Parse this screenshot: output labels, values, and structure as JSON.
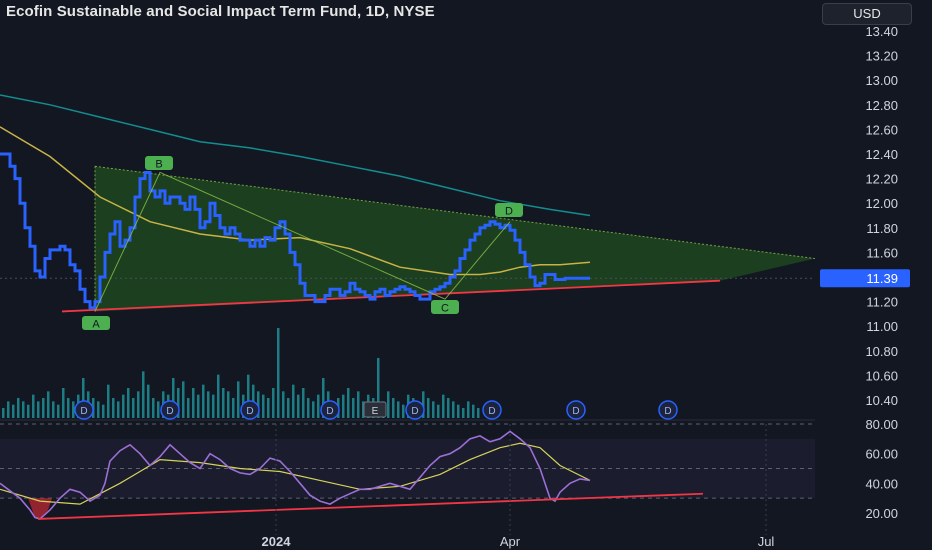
{
  "header": {
    "title": "Ecofin Sustainable and Social Impact Term Fund, 1D, NYSE",
    "currency": "USD"
  },
  "colors": {
    "background": "#131722",
    "price_line": "#2962ff",
    "triangle_fill": "#1f4d1f",
    "triangle_edge": "#8bc34a",
    "support_line": "#f23645",
    "ma_long": "#138d90",
    "ma_mid": "#c9b347",
    "rsi": "#9c6fd6",
    "rsi_ma": "#d6d35a",
    "volume": "#1f8f96",
    "label_green": "#4caf50",
    "price_badge": "#2962ff",
    "dividend_badge": "#2962ff"
  },
  "chart_data": [
    {
      "type": "line",
      "name": "price",
      "y_ticks": [
        "13.40",
        "13.20",
        "13.00",
        "12.80",
        "12.60",
        "12.40",
        "12.20",
        "12.00",
        "11.80",
        "11.60",
        "11.40",
        "11.20",
        "11.00",
        "10.80",
        "10.60",
        "10.40"
      ],
      "ylim": [
        10.35,
        13.45
      ],
      "last_price": "11.39",
      "x_ticks": [
        "2024",
        "Apr",
        "Jul"
      ],
      "series": [
        {
          "name": "Price",
          "x": [
            0,
            5,
            10,
            15,
            20,
            25,
            30,
            35,
            40,
            45,
            50,
            55,
            60,
            65,
            70,
            75,
            80,
            85,
            90,
            95,
            100,
            105,
            110,
            115,
            120,
            125,
            130,
            135,
            140,
            145,
            150,
            155,
            160,
            165,
            170,
            175,
            180,
            185,
            190,
            195,
            200,
            205,
            210,
            215,
            220,
            225,
            230,
            235,
            240,
            245,
            250,
            255,
            260,
            265,
            270,
            275,
            280,
            285,
            290,
            295,
            300,
            305,
            310,
            315,
            320,
            325,
            330,
            335,
            340,
            345,
            350,
            355,
            360,
            365,
            370,
            375,
            380,
            385,
            390,
            395,
            400,
            405,
            410,
            415,
            420,
            425,
            430,
            435,
            440,
            445,
            450,
            455,
            460,
            465,
            470,
            475,
            480,
            485,
            490,
            495,
            500,
            505,
            510,
            515,
            520,
            525,
            530,
            535,
            540,
            545,
            550,
            555,
            560,
            565,
            570,
            575,
            580,
            585,
            590
          ],
          "values": [
            12.4,
            12.4,
            12.3,
            12.2,
            12.0,
            11.8,
            11.65,
            11.45,
            11.4,
            11.55,
            11.62,
            11.62,
            11.65,
            11.62,
            11.5,
            11.45,
            11.3,
            11.2,
            11.15,
            11.2,
            11.4,
            11.6,
            11.75,
            11.85,
            11.65,
            11.7,
            11.8,
            12.05,
            12.2,
            12.25,
            12.1,
            12.05,
            12.1,
            12.0,
            12.05,
            12.05,
            12.0,
            11.95,
            12.05,
            11.95,
            11.8,
            11.85,
            12.0,
            11.9,
            11.8,
            11.75,
            11.8,
            11.75,
            11.7,
            11.7,
            11.65,
            11.7,
            11.65,
            11.72,
            11.7,
            11.8,
            11.85,
            11.75,
            11.6,
            11.5,
            11.35,
            11.25,
            11.25,
            11.2,
            11.2,
            11.25,
            11.3,
            11.3,
            11.25,
            11.28,
            11.35,
            11.3,
            11.28,
            11.25,
            11.22,
            11.28,
            11.3,
            11.25,
            11.28,
            11.3,
            11.32,
            11.3,
            11.28,
            11.25,
            11.22,
            11.22,
            11.28,
            11.3,
            11.32,
            11.35,
            11.4,
            11.45,
            11.55,
            11.62,
            11.7,
            11.75,
            11.8,
            11.82,
            11.85,
            11.83,
            11.8,
            11.82,
            11.78,
            11.7,
            11.6,
            11.5,
            11.4,
            11.33,
            11.35,
            11.42,
            11.42,
            11.38,
            11.38,
            11.39,
            11.39,
            11.39,
            11.39,
            11.39,
            11.39
          ]
        },
        {
          "name": "MA long",
          "x": [
            0,
            50,
            100,
            150,
            200,
            250,
            300,
            350,
            400,
            450,
            500,
            550,
            590
          ],
          "values": [
            12.88,
            12.8,
            12.7,
            12.6,
            12.5,
            12.45,
            12.38,
            12.3,
            12.22,
            12.12,
            12.02,
            11.95,
            11.9
          ]
        },
        {
          "name": "MA mid",
          "x": [
            0,
            50,
            100,
            150,
            200,
            250,
            300,
            350,
            400,
            450,
            480,
            500,
            520,
            540,
            560,
            590
          ],
          "values": [
            12.62,
            12.38,
            12.05,
            11.85,
            11.75,
            11.7,
            11.72,
            11.63,
            11.48,
            11.42,
            11.42,
            11.44,
            11.48,
            11.5,
            11.5,
            11.52
          ]
        }
      ]
    },
    {
      "type": "bar",
      "name": "volume",
      "values": [
        3,
        5,
        4,
        6,
        5,
        4,
        7,
        5,
        6,
        8,
        5,
        4,
        9,
        6,
        5,
        7,
        12,
        8,
        6,
        5,
        4,
        10,
        6,
        5,
        7,
        9,
        6,
        8,
        14,
        10,
        6,
        5,
        8,
        7,
        12,
        9,
        11,
        6,
        9,
        7,
        10,
        8,
        7,
        13,
        9,
        8,
        6,
        11,
        7,
        13,
        10,
        8,
        7,
        6,
        9,
        27,
        8,
        6,
        10,
        7,
        9,
        6,
        5,
        7,
        12,
        8,
        5,
        6,
        7,
        9,
        6,
        8,
        5,
        7,
        6,
        18,
        5,
        8,
        6,
        5,
        4,
        7,
        6,
        5,
        8,
        6,
        5,
        4,
        7,
        6,
        5,
        4,
        3,
        5,
        4,
        3
      ]
    },
    {
      "type": "line",
      "name": "rsi",
      "y_ticks": [
        "80.00",
        "60.00",
        "40.00",
        "20.00"
      ],
      "ylim": [
        10,
        85
      ],
      "series": [
        {
          "name": "RSI",
          "x": [
            0,
            10,
            20,
            30,
            35,
            40,
            50,
            60,
            70,
            80,
            90,
            100,
            105,
            110,
            120,
            130,
            140,
            150,
            160,
            170,
            180,
            190,
            200,
            210,
            220,
            230,
            240,
            250,
            260,
            270,
            280,
            290,
            300,
            310,
            320,
            330,
            340,
            350,
            360,
            370,
            380,
            390,
            400,
            410,
            420,
            430,
            440,
            450,
            460,
            470,
            480,
            490,
            500,
            510,
            520,
            530,
            540,
            550,
            555,
            560,
            570,
            580,
            590
          ],
          "values": [
            40,
            35,
            30,
            22,
            17,
            16,
            22,
            30,
            36,
            34,
            28,
            32,
            40,
            55,
            62,
            66,
            60,
            52,
            58,
            66,
            60,
            54,
            50,
            60,
            56,
            50,
            47,
            46,
            50,
            57,
            55,
            48,
            40,
            32,
            28,
            26,
            30,
            33,
            36,
            36,
            38,
            40,
            38,
            36,
            44,
            52,
            58,
            60,
            64,
            70,
            72,
            68,
            70,
            75,
            70,
            64,
            50,
            30,
            28,
            34,
            40,
            43,
            42
          ]
        },
        {
          "name": "RSI MA",
          "x": [
            0,
            40,
            80,
            120,
            160,
            200,
            240,
            280,
            320,
            360,
            400,
            440,
            470,
            500,
            520,
            540,
            560,
            590
          ],
          "values": [
            36,
            28,
            26,
            40,
            56,
            54,
            50,
            48,
            42,
            36,
            38,
            46,
            56,
            64,
            67,
            64,
            52,
            42
          ]
        }
      ]
    }
  ],
  "annotations": {
    "points": [
      "A",
      "B",
      "C",
      "D"
    ],
    "earnings_marker": "E",
    "dividend_marker": "D"
  }
}
